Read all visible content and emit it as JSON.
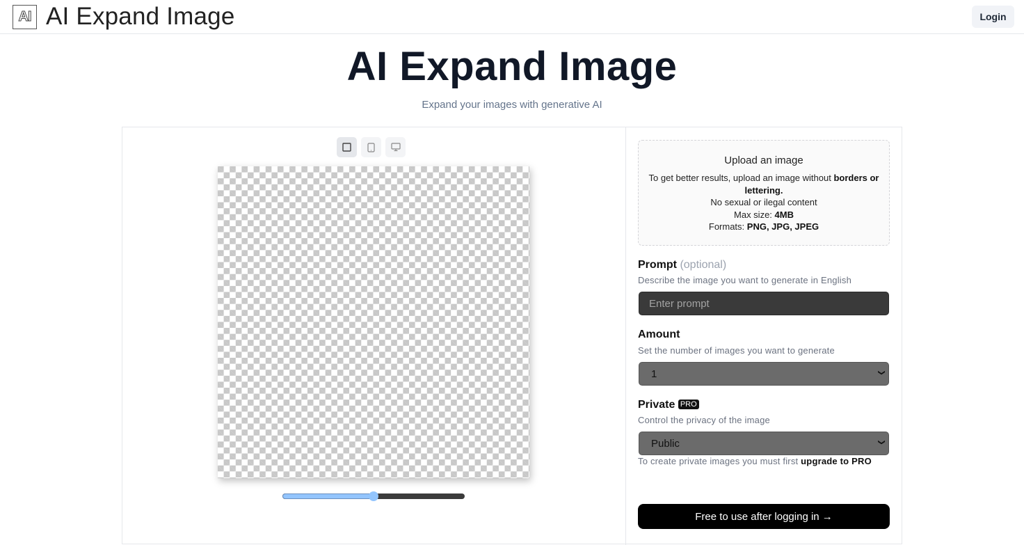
{
  "header": {
    "logo_text": "AI",
    "brand": "AI Expand Image",
    "login_label": "Login"
  },
  "hero": {
    "title": "AI Expand Image",
    "subtitle": "Expand your images with generative AI"
  },
  "editor": {
    "aspect_buttons": [
      {
        "name": "square",
        "icon": "square-icon",
        "active": true
      },
      {
        "name": "portrait",
        "icon": "tablet-icon",
        "active": false
      },
      {
        "name": "landscape",
        "icon": "monitor-icon",
        "active": false
      }
    ],
    "zoom_slider_value_percent": 50,
    "slider_color": "#93c5fd"
  },
  "upload": {
    "title": "Upload an image",
    "text_pre": "To get better results, upload an image without ",
    "text_bold": "borders or lettering.",
    "line2": "No sexual or ilegal content",
    "max_size_label": "Max size: ",
    "max_size_value": "4MB",
    "formats_label": "Formats: ",
    "formats_value": "PNG, JPG, JPEG"
  },
  "prompt": {
    "label": "Prompt",
    "optional": "(optional)",
    "description": "Describe the image you want to generate in English",
    "placeholder": "Enter prompt",
    "value": ""
  },
  "amount": {
    "label": "Amount",
    "description": "Set the number of images you want to generate",
    "selected": "1"
  },
  "private": {
    "label": "Private",
    "badge": "PRO",
    "description": "Control the privacy of the image",
    "selected": "Public",
    "note_pre": "To create private images you must first ",
    "note_bold": "upgrade to PRO"
  },
  "cta": {
    "label": "Free to use after logging in →"
  }
}
